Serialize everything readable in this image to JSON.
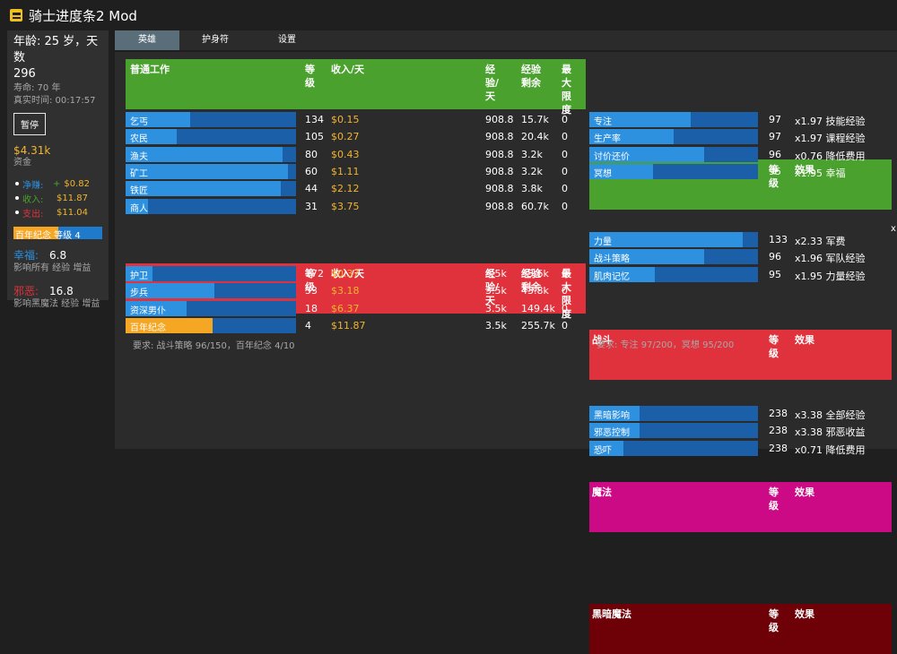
{
  "app": {
    "title": "骑士进度条2 Mod"
  },
  "sidebar": {
    "age_line": "年龄: 25 岁，天数",
    "day_number": "296",
    "lifespan": "寿命:   70 年",
    "realtime": "真实时间:   00:17:57",
    "pause_label": "暂停",
    "money": "$4.31k",
    "money_label": "资金",
    "net_label": "净赚:",
    "net_sign": "+",
    "net_value": "$0.82",
    "income_label": "收入:",
    "income_value": "$11.87",
    "expense_label": "支出:",
    "expense_value": "$11.04",
    "centennial_bar": {
      "text": "百年纪念 等级 4",
      "progress": 0.5
    },
    "happiness_label": "幸福:",
    "happiness_value": "6.8",
    "happiness_desc": "影响所有 经验 增益",
    "evil_label": "邪恶:",
    "evil_value": "16.8",
    "evil_desc": "影响黑魔法 经验 增益"
  },
  "tabs": [
    {
      "label": "英雄",
      "active": true
    },
    {
      "label": "护身符",
      "active": false
    },
    {
      "label": "设置",
      "active": false
    }
  ],
  "jobs": {
    "headers": {
      "name": "",
      "level": "等级",
      "income": "收入/天",
      "xp": "经验/天",
      "xpleft": "经验剩余",
      "maxlvl": "最大限度"
    },
    "common": {
      "title": "普通工作",
      "color": "#4aa12d",
      "rows": [
        {
          "name": "乞丐",
          "level": "134",
          "income": "$0.15",
          "xp": "908.8",
          "xpleft": "15.7k",
          "max": "0",
          "progress": 0.38
        },
        {
          "name": "农民",
          "level": "105",
          "income": "$0.27",
          "xp": "908.8",
          "xpleft": "20.4k",
          "max": "0",
          "progress": 0.3
        },
        {
          "name": "渔夫",
          "level": "80",
          "income": "$0.43",
          "xp": "908.8",
          "xpleft": "3.2k",
          "max": "0",
          "progress": 0.92
        },
        {
          "name": "矿工",
          "level": "60",
          "income": "$1.11",
          "xp": "908.8",
          "xpleft": "3.2k",
          "max": "0",
          "progress": 0.95
        },
        {
          "name": "铁匠",
          "level": "44",
          "income": "$2.12",
          "xp": "908.8",
          "xpleft": "3.8k",
          "max": "0",
          "progress": 0.91
        },
        {
          "name": "商人",
          "level": "31",
          "income": "$3.75",
          "xp": "908.8",
          "xpleft": "60.7k",
          "max": "0",
          "progress": 0.13
        }
      ]
    },
    "military": {
      "title": "军队",
      "color": "#e0323c",
      "rows": [
        {
          "name": "护卫",
          "level": "172",
          "income": "$0.37",
          "xp": "3.5k",
          "xpleft": "35.6k",
          "max": "0",
          "progress": 0.16
        },
        {
          "name": "步兵",
          "level": "53",
          "income": "$3.18",
          "xp": "3.5k",
          "xpleft": "43.8k",
          "max": "0",
          "progress": 0.52
        },
        {
          "name": "资深男仆",
          "level": "18",
          "income": "$6.37",
          "xp": "3.5k",
          "xpleft": "149.4k",
          "max": "0",
          "progress": 0.36
        },
        {
          "name": "百年纪念",
          "level": "4",
          "income": "$11.87",
          "xp": "3.5k",
          "xpleft": "255.7k",
          "max": "0",
          "progress": 0.51,
          "highlight": true
        }
      ]
    },
    "requirement": "要求:   战斗策略 96/150，百年纪念 4/10"
  },
  "skills": {
    "headers": {
      "level": "等级",
      "effect": "效果"
    },
    "fundamentals": {
      "title": "基本原理",
      "color": "#4aa12d",
      "rows": [
        {
          "name": "专注",
          "level": "97",
          "effect": "x1.97 技能经验",
          "progress": 0.6
        },
        {
          "name": "生产率",
          "level": "97",
          "effect": "x1.97 课程经验",
          "progress": 0.5
        },
        {
          "name": "讨价还价",
          "level": "96",
          "effect": "x0.76 降低费用",
          "progress": 0.68
        },
        {
          "name": "冥想",
          "level": "95",
          "effect": "x1.95 幸福",
          "progress": 0.38
        }
      ]
    },
    "combat": {
      "title": "战斗",
      "color": "#e0323c",
      "rows": [
        {
          "name": "力量",
          "level": "133",
          "effect": "x2.33 军费",
          "progress": 0.91
        },
        {
          "name": "战斗策略",
          "level": "96",
          "effect": "x1.96 军队经验",
          "progress": 0.68
        },
        {
          "name": "肌肉记忆",
          "level": "95",
          "effect": "x1.95 力量经验",
          "progress": 0.39
        }
      ]
    },
    "magic": {
      "title": "魔法",
      "color": "#cc0a85",
      "rows": [],
      "requirement": "要求:   专注 97/200，冥想 95/200"
    },
    "dark_magic": {
      "title": "黑暗魔法",
      "color": "#6e0008",
      "rows": [
        {
          "name": "黑暗影响",
          "level": "238",
          "effect": "x3.38 全部经验",
          "progress": 0.3
        },
        {
          "name": "邪恶控制",
          "level": "238",
          "effect": "x3.38 邪恶收益",
          "progress": 0.3
        },
        {
          "name": "恐吓",
          "level": "238",
          "effect": "x0.71 降低费用",
          "progress": 0.2
        }
      ]
    }
  },
  "icons": {
    "app_logo": "knight-helmet-icon",
    "close": "close-icon"
  },
  "colors": {
    "money": "#f2b52e",
    "net": "#2e91e0",
    "income": "#4aa12d",
    "expense": "#e0323c",
    "bar_fill": "#2e91e0",
    "bar_bg": "#1a5fa8",
    "highlight_fill": "#f5a623"
  }
}
